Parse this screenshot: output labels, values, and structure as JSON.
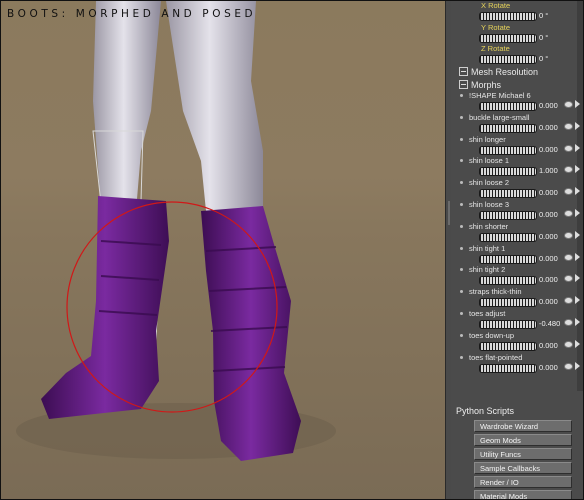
{
  "viewport": {
    "title": "BOOTS: MORPHED AND POSED"
  },
  "rotations": [
    {
      "label": "X Rotate",
      "value": "0 °"
    },
    {
      "label": "Y Rotate",
      "value": "0 °"
    },
    {
      "label": "Z Rotate",
      "value": "0 °"
    }
  ],
  "sections": {
    "mesh_resolution": "Mesh Resolution",
    "morphs": "Morphs"
  },
  "morphs": [
    {
      "label": "!SHAPE Michael 6",
      "value": "0.000"
    },
    {
      "label": "buckle large-small",
      "value": "0.000"
    },
    {
      "label": "shin longer",
      "value": "0.000"
    },
    {
      "label": "shin loose 1",
      "value": "1.000"
    },
    {
      "label": "shin loose 2",
      "value": "0.000"
    },
    {
      "label": "shin loose 3",
      "value": "0.000"
    },
    {
      "label": "shin shorter",
      "value": "0.000"
    },
    {
      "label": "shin tight 1",
      "value": "0.000"
    },
    {
      "label": "shin tight 2",
      "value": "0.000"
    },
    {
      "label": "straps thick-thin",
      "value": "0.000"
    },
    {
      "label": "toes adjust",
      "value": "-0.480"
    },
    {
      "label": "toes down-up",
      "value": "0.000"
    },
    {
      "label": "toes flat-pointed",
      "value": "0.000"
    }
  ],
  "python": {
    "title": "Python Scripts",
    "buttons": [
      "Wardrobe Wizard",
      "Geom Mods",
      "Utility Funcs",
      "Sample Callbacks",
      "Render / IO",
      "Material Mods"
    ]
  },
  "colors": {
    "boot": "#6a1e8a",
    "selection_circle": "#d01818",
    "panel_bg": "#4b4b4b",
    "rotate_label": "#e6d35a"
  }
}
